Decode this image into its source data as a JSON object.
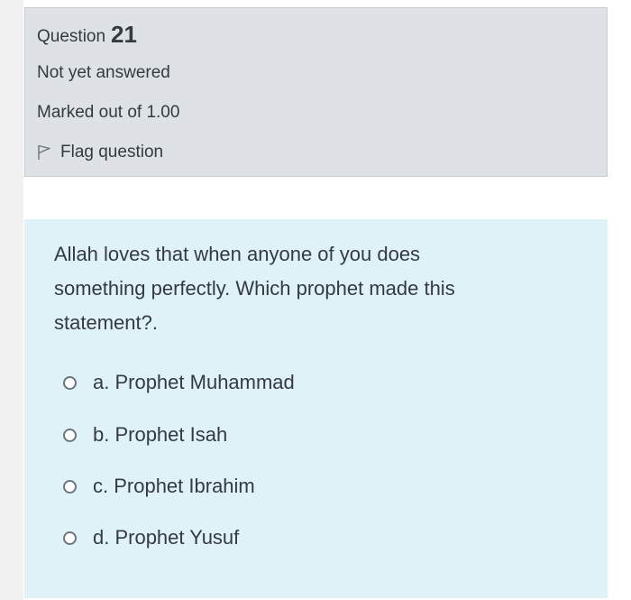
{
  "question": {
    "label": "Question",
    "number": "21",
    "state": "Not yet answered",
    "grade": "Marked out of 1.00",
    "flag_label": "Flag question"
  },
  "qtext": {
    "line1": "Allah loves that when anyone of you does",
    "line2": "something perfectly.  Which prophet made this",
    "line3": "statement?."
  },
  "options": [
    {
      "label": "a. Prophet Muhammad"
    },
    {
      "label": "b. Prophet Isah"
    },
    {
      "label": "c. Prophet Ibrahim"
    },
    {
      "label": "d. Prophet Yusuf"
    }
  ],
  "colors": {
    "info_bg": "#dee2e6",
    "formulation_bg": "#def2f8",
    "text": "#343a40"
  }
}
